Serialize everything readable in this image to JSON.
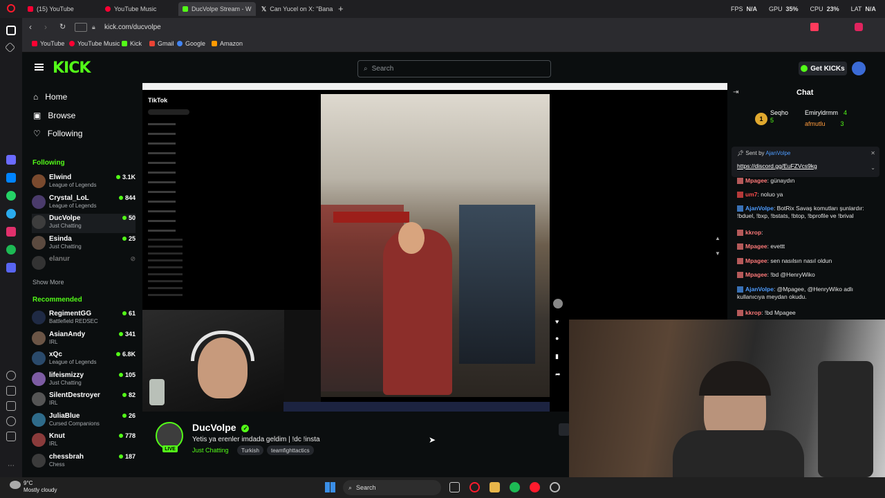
{
  "browser": {
    "tabs": [
      {
        "label": "(15) YouTube",
        "color": "#ff0033"
      },
      {
        "label": "YouTube Music",
        "color": "#ff0033"
      },
      {
        "label": "DucVolpe Stream - W",
        "color": "#53fc18"
      },
      {
        "label": "Can Yucel on X: \"Bana g",
        "color": "#ffffff"
      }
    ],
    "url": "kick.com/ducvolpe",
    "stats": {
      "fps_label": "FPS",
      "fps_value": "N/A",
      "gpu_label": "GPU",
      "gpu_value": "35%",
      "cpu_label": "CPU",
      "cpu_value": "23%",
      "lat_label": "LAT",
      "lat_value": "N/A"
    },
    "bookmarks": [
      "YouTube",
      "YouTube Music",
      "Kick",
      "Gmail",
      "Google",
      "Amazon"
    ]
  },
  "kick": {
    "logo": "KICK",
    "search_placeholder": "Search",
    "get_kicks": "Get KICKs",
    "nav": [
      "Home",
      "Browse",
      "Following"
    ],
    "following_heading": "Following",
    "following": [
      {
        "name": "Elwind",
        "category": "League of Legends",
        "viewers": "3.1K",
        "color": "#7a4a2e"
      },
      {
        "name": "Crystal_LoL",
        "category": "League of Legends",
        "viewers": "844",
        "color": "#4a3b6b"
      },
      {
        "name": "DucVolpe",
        "category": "Just Chatting",
        "viewers": "50",
        "color": "#3d3d3d"
      },
      {
        "name": "Esinda",
        "category": "Just Chatting",
        "viewers": "25",
        "color": "#5b4a3f"
      },
      {
        "name": "elanur",
        "category": "",
        "viewers": "",
        "color": "#333333"
      }
    ],
    "show_more": "Show More",
    "recommended_heading": "Recommended",
    "recommended": [
      {
        "name": "RegimentGG",
        "category": "Battlefield REDSEC",
        "viewers": "61",
        "color": "#1f2a44"
      },
      {
        "name": "AsianAndy",
        "category": "IRL",
        "viewers": "341",
        "color": "#6b5546"
      },
      {
        "name": "xQc",
        "category": "League of Legends",
        "viewers": "6.8K",
        "color": "#2a4a6b"
      },
      {
        "name": "lifeismizzy",
        "category": "Just Chatting",
        "viewers": "105",
        "color": "#7d5ca3"
      },
      {
        "name": "SilentDestroyer",
        "category": "IRL",
        "viewers": "82",
        "color": "#555555"
      },
      {
        "name": "JuliaBlue",
        "category": "Cursed Companions",
        "viewers": "26",
        "color": "#2e6b8a"
      },
      {
        "name": "Knut",
        "category": "IRL",
        "viewers": "778",
        "color": "#8a3b3b"
      },
      {
        "name": "chessbrah",
        "category": "Chess",
        "viewers": "187",
        "color": "#3b3b3b"
      }
    ]
  },
  "stream": {
    "name": "DucVolpe",
    "live_badge": "LIVE",
    "title": "Yetis ya erenler imdada geldim | !dc !insta",
    "category": "Just Chatting",
    "tags": [
      "Turkish",
      "teamfighttactics"
    ],
    "tiktok_logo": "TikTok"
  },
  "chat": {
    "title": "Chat",
    "top_gifters": [
      {
        "name": "Seqho",
        "count": "5"
      },
      {
        "name": "Emiryldrmm",
        "count": "4"
      },
      {
        "name": "afmutlu",
        "count": "3"
      }
    ],
    "pinned_sent_by": "Sent by",
    "pinned_user": "AjanVolpe",
    "pinned_link": "https://discord.gg/EuFZVcs9kg",
    "messages": [
      {
        "user": "Mpagee",
        "text": ": günaydın",
        "color": "#ff7a7a"
      },
      {
        "user": "um7",
        "text": ": noluo ya",
        "color": "#ff4d4d"
      },
      {
        "user": "AjanVolpe",
        "text": ": BotRix Savaş komutları şunlardır: !bduel, !bxp, !bstats, !btop, !bprofile ve !brival",
        "color": "#4d9cff"
      },
      {
        "user": "kkrop",
        "text": ": ",
        "color": "#ff7a7a"
      },
      {
        "user": "Mpagee",
        "text": ": evettt",
        "color": "#ff7a7a"
      },
      {
        "user": "Mpagee",
        "text": ": sen nasılsın nasıl oldun",
        "color": "#ff7a7a"
      },
      {
        "user": "Mpagee",
        "text": ": !bd @HenryWiko",
        "color": "#ff7a7a"
      },
      {
        "user": "AjanVolpe",
        "text": ": @Mpagee, @HenryWiko adlı kullanıcıya meydan okudu.",
        "color": "#4d9cff"
      },
      {
        "user": "kkrop",
        "text": ": !bd Mpagee",
        "color": "#ff7a7a"
      }
    ]
  },
  "taskbar": {
    "temp": "9°C",
    "weather": "Mostly cloudy",
    "search": "Search"
  }
}
